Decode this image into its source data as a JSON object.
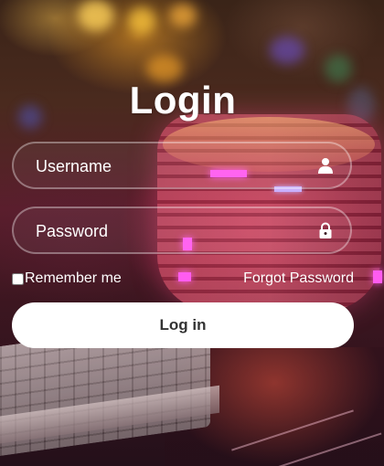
{
  "form": {
    "title": "Login",
    "username_placeholder": "Username",
    "password_placeholder": "Password",
    "remember_label": "Remember me",
    "forgot_label": "Forgot Password",
    "submit_label": "Log in"
  },
  "icons": {
    "username": "user-icon",
    "password": "lock-icon"
  },
  "colors": {
    "text": "#ffffff",
    "button_bg": "#ffffff",
    "button_text": "#333333"
  }
}
